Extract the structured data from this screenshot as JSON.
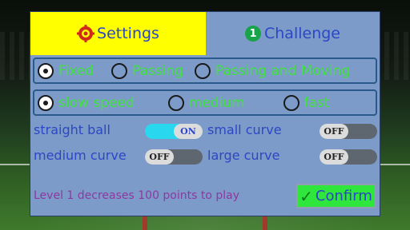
{
  "tabs": {
    "settings_label": "Settings",
    "challenge_label": "Challenge",
    "challenge_badge": "1"
  },
  "mode": {
    "options": [
      "Fixed",
      "Passing",
      "Passing and Moving"
    ],
    "selected": "Fixed"
  },
  "speed": {
    "options": [
      "slow speed",
      "medium",
      "fast"
    ],
    "selected": "slow speed"
  },
  "curves": {
    "straight_ball": {
      "label": "straight ball",
      "state": "ON"
    },
    "small_curve": {
      "label": "small curve",
      "state": "OFF"
    },
    "medium_curve": {
      "label": "medium curve",
      "state": "OFF"
    },
    "large_curve": {
      "label": "large curve",
      "state": "OFF"
    }
  },
  "note": "Level 1 decreases 100 points to play",
  "confirm_label": "Confirm",
  "colors": {
    "panel": "#7d9bc8",
    "tab_active": "#ffff00",
    "option_text": "#3fe23f",
    "label_text": "#2b47c7",
    "toggle_on": "#29d7ee",
    "toggle_off": "#5e6670",
    "confirm_bg": "#2fe63c",
    "note_text": "#8a3aa0"
  }
}
